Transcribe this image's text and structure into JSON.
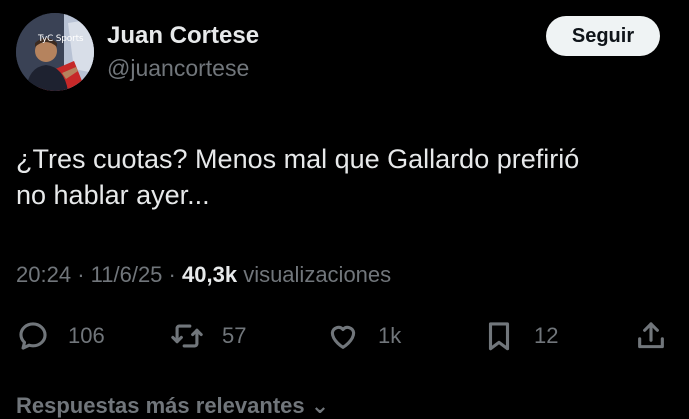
{
  "author": {
    "display_name": "Juan Cortese",
    "handle": "@juancortese",
    "avatar_logo_text": "TyC Sports"
  },
  "follow_button": {
    "label": "Seguir"
  },
  "tweet": {
    "line1": "¿Tres cuotas? Menos mal que Gallardo prefirió",
    "line2": "no hablar ayer..."
  },
  "meta": {
    "time": "20:24",
    "date": "11/6/25",
    "views_count": "40,3k",
    "views_label": "visualizaciones"
  },
  "actions": {
    "replies": "106",
    "reposts": "57",
    "likes": "1k",
    "bookmarks": "12"
  },
  "footer": {
    "more_replies_label": "Respuestas más relevantes"
  },
  "colors": {
    "background": "#000000",
    "primary_text": "#e7e9ea",
    "secondary_text": "#71767b",
    "button_bg": "#eff3f4"
  }
}
